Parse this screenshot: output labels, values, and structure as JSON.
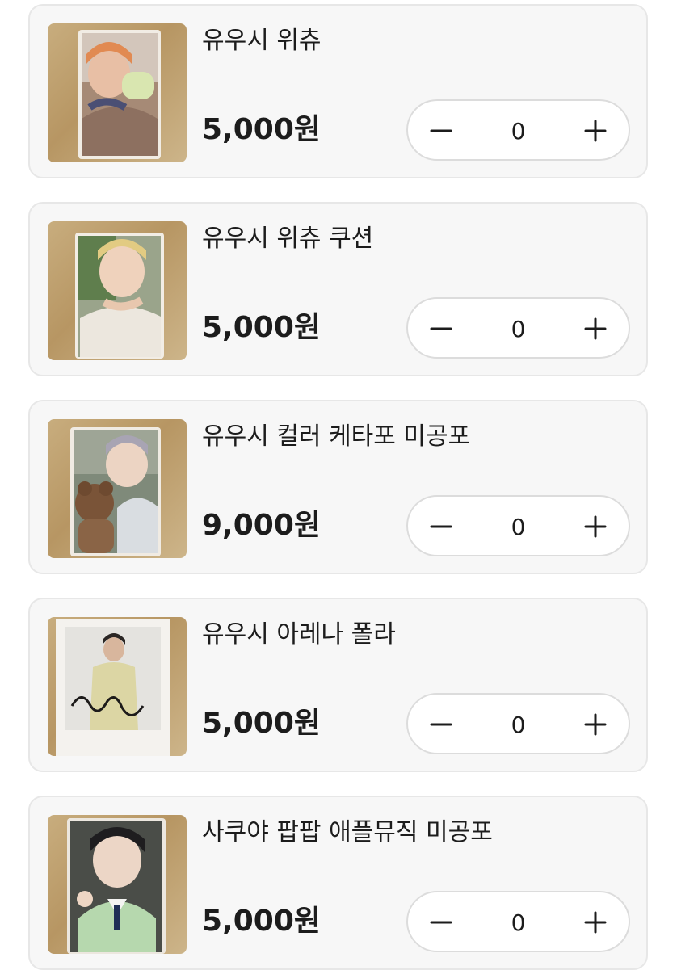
{
  "colors": {
    "card_background": "#f7f7f7",
    "card_border": "#e7e7e7",
    "text": "#1c1c1c",
    "stepper_background": "#ffffff",
    "stepper_border": "#dcdcdc"
  },
  "products": [
    {
      "name": "유우시 위츄",
      "price": "5,000원",
      "quantity": "0",
      "minus_icon": "minus-icon",
      "plus_icon": "plus-icon"
    },
    {
      "name": "유우시 위츄 쿠션",
      "price": "5,000원",
      "quantity": "0",
      "minus_icon": "minus-icon",
      "plus_icon": "plus-icon"
    },
    {
      "name": "유우시 컬러 케타포 미공포",
      "price": "9,000원",
      "quantity": "0",
      "minus_icon": "minus-icon",
      "plus_icon": "plus-icon"
    },
    {
      "name": "유우시 아레나 폴라",
      "price": "5,000원",
      "quantity": "0",
      "minus_icon": "minus-icon",
      "plus_icon": "plus-icon"
    },
    {
      "name": "사쿠야 팝팝 애플뮤직 미공포",
      "price": "5,000원",
      "quantity": "0",
      "minus_icon": "minus-icon",
      "plus_icon": "plus-icon"
    }
  ]
}
